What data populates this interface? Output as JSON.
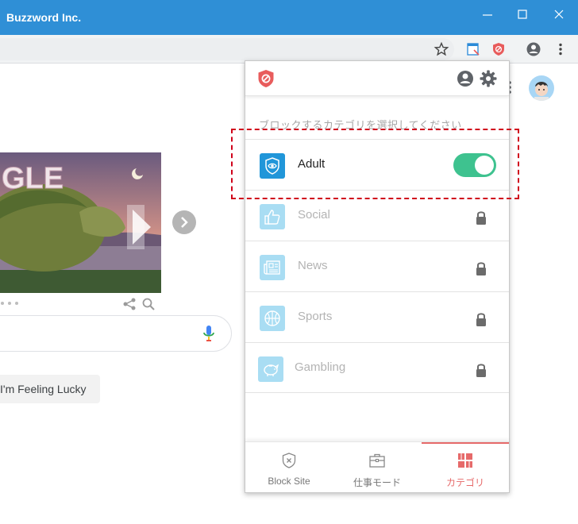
{
  "window": {
    "title": "Buzzword Inc."
  },
  "google": {
    "lucky_button": "I'm Feeling Lucky",
    "doodle_text": "GLE"
  },
  "popup": {
    "instruction": "ブロックするカテゴリを選択してください",
    "categories": [
      {
        "label": "Adult",
        "enabled": true,
        "locked": false,
        "icon": "eye-shield-icon",
        "color": "#2196d9"
      },
      {
        "label": "Social",
        "enabled": false,
        "locked": true,
        "icon": "thumbs-up-icon",
        "color": "#a9ddf3"
      },
      {
        "label": "News",
        "enabled": false,
        "locked": true,
        "icon": "newspaper-icon",
        "color": "#a9ddf3"
      },
      {
        "label": "Sports",
        "enabled": false,
        "locked": true,
        "icon": "basketball-icon",
        "color": "#a9ddf3"
      },
      {
        "label": "Gambling",
        "enabled": false,
        "locked": true,
        "icon": "piggy-bank-icon",
        "color": "#a9ddf3"
      }
    ],
    "nav": [
      {
        "label": "Block Site",
        "icon": "shield-x-icon",
        "active": false
      },
      {
        "label": "仕事モード",
        "icon": "briefcase-icon",
        "active": false
      },
      {
        "label": "カテゴリ",
        "icon": "grid-icon",
        "active": true
      }
    ]
  },
  "colors": {
    "titlebar": "#2f8fd6",
    "toggle_on": "#3ec28f",
    "accent_red": "#e66a6a",
    "brand_red": "#e85c5c",
    "highlight": "#d0021b"
  }
}
